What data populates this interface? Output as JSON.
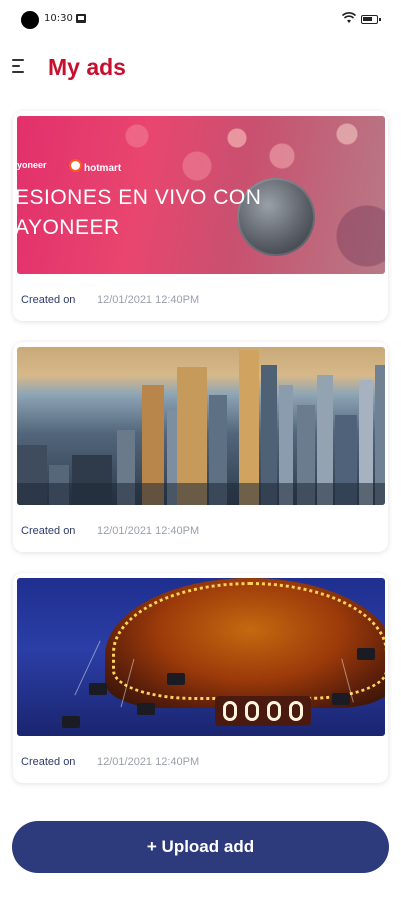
{
  "status_bar": {
    "time": "10:30"
  },
  "header": {
    "title": "My ads"
  },
  "ads": [
    {
      "image_logo_left": "yoneer",
      "image_logo_right": "hotmart",
      "image_headline_1": "ESIONES EN VIVO CON",
      "image_headline_2": "AYONEER",
      "created_label": "Created on",
      "created_date": "12/01/2021 12:40PM"
    },
    {
      "created_label": "Created on",
      "created_date": "12/01/2021 12:40PM"
    },
    {
      "created_label": "Created on",
      "created_date": "12/01/2021 12:40PM"
    }
  ],
  "upload_button": {
    "label": "+ Upload add"
  },
  "colors": {
    "title": "#c8102e",
    "button": "#2d3a7c",
    "label": "#2d3a6b",
    "date": "#9aa0aa"
  }
}
